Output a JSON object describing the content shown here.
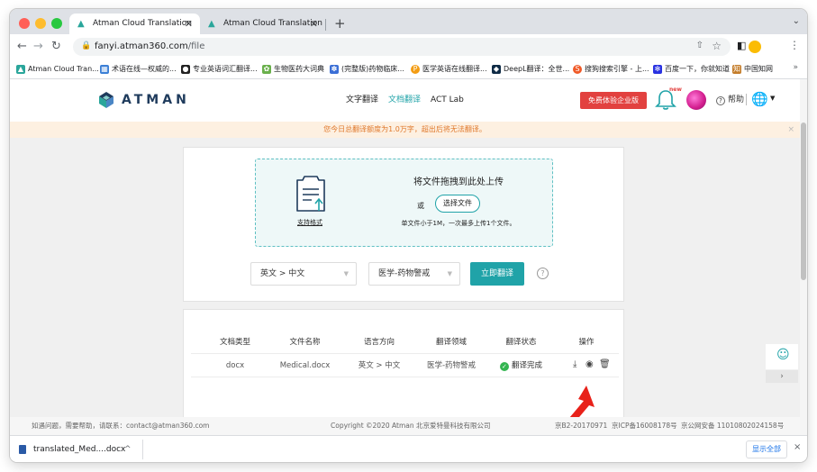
{
  "browser": {
    "tabs": [
      {
        "title": "Atman Cloud Translation",
        "active": true
      },
      {
        "title": "Atman Cloud Translation",
        "active": false
      }
    ],
    "new_tab": "+",
    "url_host": "fanyi.atman360.com",
    "url_path": "/file",
    "bookmarks": [
      {
        "label": "Atman Cloud Tran...",
        "icon": "atman-icon",
        "color": "#2aa69b"
      },
      {
        "label": "术语在线—权威的...",
        "icon": "grid-icon",
        "color": "#3b7fd6"
      },
      {
        "label": "专业英语词汇翻译...",
        "icon": "globe-icon",
        "color": "#222222"
      },
      {
        "label": "生物医药大词典",
        "icon": "leaf-icon",
        "color": "#6ab04c"
      },
      {
        "label": "(完整版)药物临床...",
        "icon": "paw-icon",
        "color": "#3b6fd6"
      },
      {
        "label": "医学英语在线翻译...",
        "icon": "p-icon",
        "color": "#f39c12"
      },
      {
        "label": "DeepL翻译：全世...",
        "icon": "deepl-icon",
        "color": "#0f2b46"
      },
      {
        "label": "搜狗搜索引擎 - 上...",
        "icon": "sogou-icon",
        "color": "#f05a28"
      },
      {
        "label": "百度一下，你就知道",
        "icon": "baidu-icon",
        "color": "#2932e1"
      },
      {
        "label": "中国知网",
        "icon": "cnki-icon",
        "color": "#c47d2a"
      }
    ],
    "bookmarks_more": "»"
  },
  "header": {
    "logo_text": "ATMAN",
    "nav": [
      {
        "label": "文字翻译",
        "active": false
      },
      {
        "label": "文档翻译",
        "active": true
      },
      {
        "label": "ACT Lab",
        "active": false
      }
    ],
    "promo_button": "免费体验企业版",
    "new_badge": "new",
    "help": "帮助",
    "help_icon": "?"
  },
  "notice": {
    "text": "您今日总翻译额度为1.0万字，超出后将无法翻译。",
    "close": "×"
  },
  "upload": {
    "title": "将文件拖拽到此处上传",
    "or": "或",
    "choose_button": "选择文件",
    "hint": "单文件小于1M，一次最多上传1个文件。",
    "formats_link": "支持格式",
    "language_select": "英文 > 中文",
    "domain_select": "医学-药物警戒",
    "translate_button": "立即翻译",
    "help_icon": "?"
  },
  "files_table": {
    "columns": [
      "文档类型",
      "文件名称",
      "语言方向",
      "翻译领域",
      "翻译状态",
      "操作"
    ],
    "rows": [
      {
        "type": "docx",
        "name": "Medical.docx",
        "direction": "英文 > 中文",
        "domain": "医学-药物警戒",
        "status": "翻译完成"
      }
    ]
  },
  "footer": {
    "contact": "如遇问题，需要帮助，请联系：contact@atman360.com",
    "copyright": "Copyright ©2020 Atman  北京爱特曼科技有限公司",
    "license": "京B2-20170971",
    "icp": "京ICP备16008178号",
    "police": "京公网安备 11010802024158号"
  },
  "downloads": {
    "file": "translated_Med....docx",
    "show_all": "显示全部",
    "close": "×"
  },
  "colors": {
    "accent": "#20a3a8",
    "promo": "#e2413f",
    "notice_text": "#e0782b",
    "success": "#34b551",
    "arrow": "#e8211a"
  }
}
